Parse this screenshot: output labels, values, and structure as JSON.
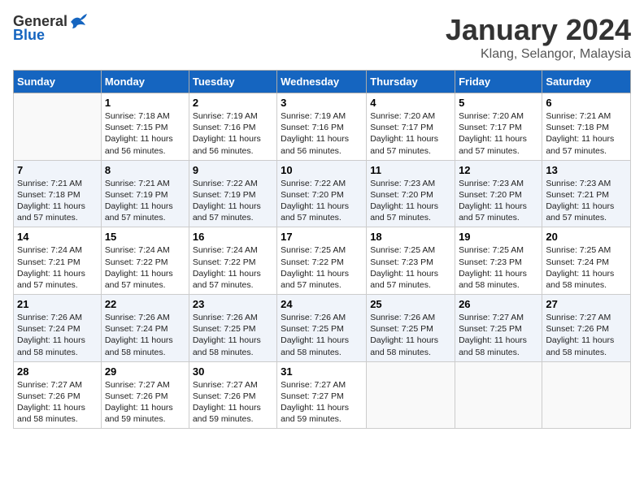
{
  "logo": {
    "general": "General",
    "blue": "Blue"
  },
  "title": "January 2024",
  "subtitle": "Klang, Selangor, Malaysia",
  "days_of_week": [
    "Sunday",
    "Monday",
    "Tuesday",
    "Wednesday",
    "Thursday",
    "Friday",
    "Saturday"
  ],
  "weeks": [
    [
      {
        "day": "",
        "info": ""
      },
      {
        "day": "1",
        "info": "Sunrise: 7:18 AM\nSunset: 7:15 PM\nDaylight: 11 hours\nand 56 minutes."
      },
      {
        "day": "2",
        "info": "Sunrise: 7:19 AM\nSunset: 7:16 PM\nDaylight: 11 hours\nand 56 minutes."
      },
      {
        "day": "3",
        "info": "Sunrise: 7:19 AM\nSunset: 7:16 PM\nDaylight: 11 hours\nand 56 minutes."
      },
      {
        "day": "4",
        "info": "Sunrise: 7:20 AM\nSunset: 7:17 PM\nDaylight: 11 hours\nand 57 minutes."
      },
      {
        "day": "5",
        "info": "Sunrise: 7:20 AM\nSunset: 7:17 PM\nDaylight: 11 hours\nand 57 minutes."
      },
      {
        "day": "6",
        "info": "Sunrise: 7:21 AM\nSunset: 7:18 PM\nDaylight: 11 hours\nand 57 minutes."
      }
    ],
    [
      {
        "day": "7",
        "info": "Sunrise: 7:21 AM\nSunset: 7:18 PM\nDaylight: 11 hours\nand 57 minutes."
      },
      {
        "day": "8",
        "info": "Sunrise: 7:21 AM\nSunset: 7:19 PM\nDaylight: 11 hours\nand 57 minutes."
      },
      {
        "day": "9",
        "info": "Sunrise: 7:22 AM\nSunset: 7:19 PM\nDaylight: 11 hours\nand 57 minutes."
      },
      {
        "day": "10",
        "info": "Sunrise: 7:22 AM\nSunset: 7:20 PM\nDaylight: 11 hours\nand 57 minutes."
      },
      {
        "day": "11",
        "info": "Sunrise: 7:23 AM\nSunset: 7:20 PM\nDaylight: 11 hours\nand 57 minutes."
      },
      {
        "day": "12",
        "info": "Sunrise: 7:23 AM\nSunset: 7:20 PM\nDaylight: 11 hours\nand 57 minutes."
      },
      {
        "day": "13",
        "info": "Sunrise: 7:23 AM\nSunset: 7:21 PM\nDaylight: 11 hours\nand 57 minutes."
      }
    ],
    [
      {
        "day": "14",
        "info": "Sunrise: 7:24 AM\nSunset: 7:21 PM\nDaylight: 11 hours\nand 57 minutes."
      },
      {
        "day": "15",
        "info": "Sunrise: 7:24 AM\nSunset: 7:22 PM\nDaylight: 11 hours\nand 57 minutes."
      },
      {
        "day": "16",
        "info": "Sunrise: 7:24 AM\nSunset: 7:22 PM\nDaylight: 11 hours\nand 57 minutes."
      },
      {
        "day": "17",
        "info": "Sunrise: 7:25 AM\nSunset: 7:22 PM\nDaylight: 11 hours\nand 57 minutes."
      },
      {
        "day": "18",
        "info": "Sunrise: 7:25 AM\nSunset: 7:23 PM\nDaylight: 11 hours\nand 57 minutes."
      },
      {
        "day": "19",
        "info": "Sunrise: 7:25 AM\nSunset: 7:23 PM\nDaylight: 11 hours\nand 58 minutes."
      },
      {
        "day": "20",
        "info": "Sunrise: 7:25 AM\nSunset: 7:24 PM\nDaylight: 11 hours\nand 58 minutes."
      }
    ],
    [
      {
        "day": "21",
        "info": "Sunrise: 7:26 AM\nSunset: 7:24 PM\nDaylight: 11 hours\nand 58 minutes."
      },
      {
        "day": "22",
        "info": "Sunrise: 7:26 AM\nSunset: 7:24 PM\nDaylight: 11 hours\nand 58 minutes."
      },
      {
        "day": "23",
        "info": "Sunrise: 7:26 AM\nSunset: 7:25 PM\nDaylight: 11 hours\nand 58 minutes."
      },
      {
        "day": "24",
        "info": "Sunrise: 7:26 AM\nSunset: 7:25 PM\nDaylight: 11 hours\nand 58 minutes."
      },
      {
        "day": "25",
        "info": "Sunrise: 7:26 AM\nSunset: 7:25 PM\nDaylight: 11 hours\nand 58 minutes."
      },
      {
        "day": "26",
        "info": "Sunrise: 7:27 AM\nSunset: 7:25 PM\nDaylight: 11 hours\nand 58 minutes."
      },
      {
        "day": "27",
        "info": "Sunrise: 7:27 AM\nSunset: 7:26 PM\nDaylight: 11 hours\nand 58 minutes."
      }
    ],
    [
      {
        "day": "28",
        "info": "Sunrise: 7:27 AM\nSunset: 7:26 PM\nDaylight: 11 hours\nand 58 minutes."
      },
      {
        "day": "29",
        "info": "Sunrise: 7:27 AM\nSunset: 7:26 PM\nDaylight: 11 hours\nand 59 minutes."
      },
      {
        "day": "30",
        "info": "Sunrise: 7:27 AM\nSunset: 7:26 PM\nDaylight: 11 hours\nand 59 minutes."
      },
      {
        "day": "31",
        "info": "Sunrise: 7:27 AM\nSunset: 7:27 PM\nDaylight: 11 hours\nand 59 minutes."
      },
      {
        "day": "",
        "info": ""
      },
      {
        "day": "",
        "info": ""
      },
      {
        "day": "",
        "info": ""
      }
    ]
  ]
}
